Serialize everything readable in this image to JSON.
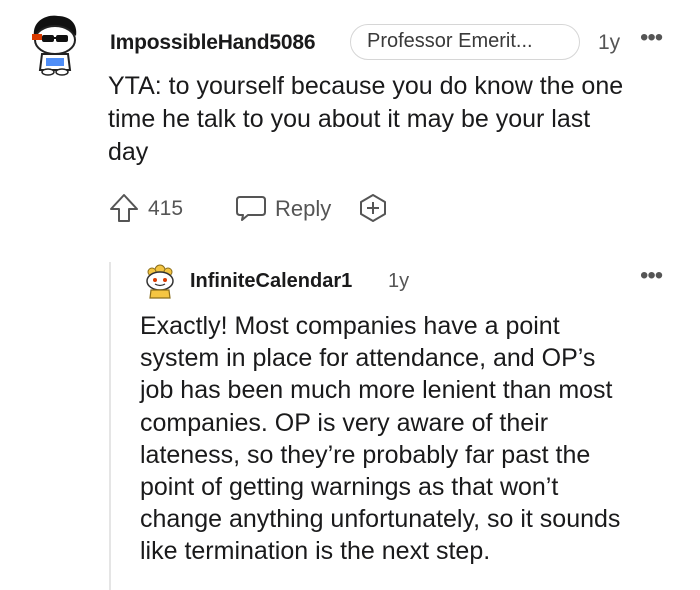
{
  "comment": {
    "author": "ImpossibleHand5086",
    "flair": "Professor Emerit...",
    "age": "1y",
    "more": "•••",
    "body_lines": [
      "YTA: to yourself because you do know the one",
      "time he talk to you about it may be your last",
      "day"
    ],
    "actions": {
      "score": "415",
      "reply_label": "Reply"
    }
  },
  "reply": {
    "author": "InfiniteCalendar1",
    "age": "1y",
    "more": "•••",
    "body_lines": [
      "Exactly! Most companies have a point",
      "system in place for attendance, and OP’s",
      "job has been much more lenient than most",
      "companies. OP is very aware of their",
      "lateness, so they’re probably far past the",
      "point of getting warnings as that won’t",
      "change anything unfortunately, so it sounds",
      "like termination is the next step."
    ]
  },
  "icons": {
    "upvote": "upvote-icon",
    "reply": "reply-bubble-icon",
    "award": "add-award-icon",
    "more": "more-options-icon"
  }
}
